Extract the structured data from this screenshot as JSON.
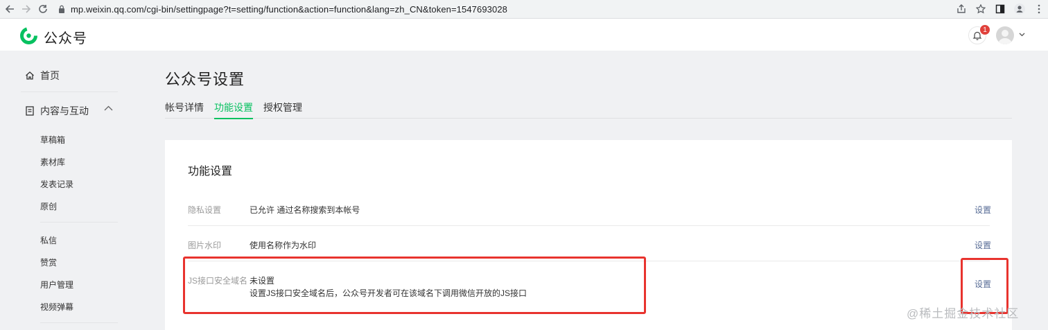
{
  "browser": {
    "url": "mp.weixin.qq.com/cgi-bin/settingpage?t=setting/function&action=function&lang=zh_CN&token=1547693028"
  },
  "header": {
    "brand": "公众号",
    "notification_count": "1"
  },
  "sidebar": {
    "home": "首页",
    "content_group": "内容与互动",
    "content_items": [
      "草稿箱",
      "素材库",
      "发表记录",
      "原创"
    ],
    "interact_items": [
      "私信",
      "赞赏",
      "用户管理",
      "视频弹幕"
    ]
  },
  "main": {
    "title": "公众号设置",
    "tabs": [
      {
        "label": "帐号详情",
        "active": false
      },
      {
        "label": "功能设置",
        "active": true
      },
      {
        "label": "授权管理",
        "active": false
      }
    ],
    "section_title": "功能设置",
    "rows": [
      {
        "label": "隐私设置",
        "value": "已允许 通过名称搜索到本帐号",
        "action": "设置"
      },
      {
        "label": "图片水印",
        "value": "使用名称作为水印",
        "action": "设置"
      },
      {
        "label": "JS接口安全域名",
        "value": "未设置",
        "description": "设置JS接口安全域名后，公众号开发者可在该域名下调用微信开放的JS接口",
        "action": "设置"
      }
    ]
  },
  "watermark": "@稀土掘金技术社区",
  "colors": {
    "accent": "#07c160",
    "link": "#576b95",
    "highlight": "#e8332e",
    "badge": "#e0413b"
  }
}
